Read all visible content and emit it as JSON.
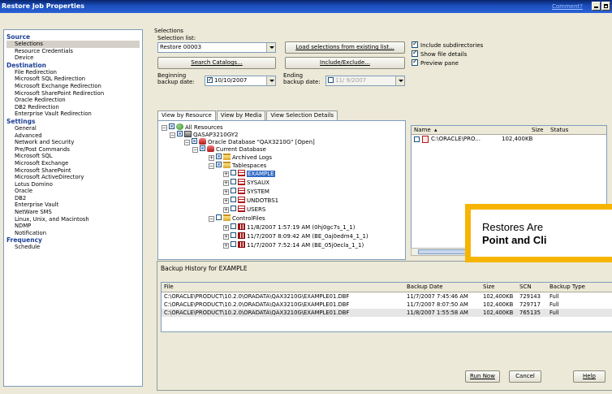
{
  "window": {
    "title": "Restore Job Properties",
    "help_link": "Comment?"
  },
  "nav": [
    {
      "group": "Source",
      "items": [
        "Selections",
        "Resource Credentials",
        "Device"
      ],
      "selected": 0
    },
    {
      "group": "Destination",
      "items": [
        "File Redirection",
        "Microsoft SQL Redirection",
        "Microsoft Exchange Redirection",
        "Microsoft SharePoint Redirection",
        "Oracle Redirection",
        "DB2 Redirection",
        "Enterprise Vault Redirection"
      ]
    },
    {
      "group": "Settings",
      "items": [
        "General",
        "Advanced",
        "Network and Security",
        "Pre/Post Commands",
        "Microsoft SQL",
        "Microsoft Exchange",
        "Microsoft SharePoint",
        "Microsoft ActiveDirectory",
        "Lotus Domino",
        "Oracle",
        "DB2",
        "Enterprise Vault",
        "NetWare SMS",
        "Linux, Unix, and Macintosh",
        "NDMP",
        "Notification"
      ]
    },
    {
      "group": "Frequency",
      "items": [
        "Schedule"
      ]
    }
  ],
  "selections": {
    "section_label": "Selections",
    "list_label": "Selection list:",
    "list_value": "Restore 00003",
    "load_button": "Load selections from existing list...",
    "search_button": "Search Catalogs...",
    "include_button": "Include/Exclude...",
    "begin_label": "Beginning backup date:",
    "begin_value": "10/10/2007",
    "end_label": "Ending backup date:",
    "end_value": "11/ 9/2007",
    "options": [
      {
        "label": "Include subdirectories",
        "checked": true
      },
      {
        "label": "Show file details",
        "checked": true
      },
      {
        "label": "Preview pane",
        "checked": true
      }
    ]
  },
  "tabs": [
    "View by Resource",
    "View by Media",
    "View Selection Details"
  ],
  "tree": [
    {
      "label": "All Resources",
      "icon": "globe-icon"
    },
    {
      "label": "QASAP3210GY2",
      "icon": "server-icon"
    },
    {
      "label": "Oracle Database \"QAX3210G\" [Open]",
      "icon": "database-icon"
    },
    {
      "label": "Current Database",
      "icon": "database-icon"
    },
    {
      "label": "Archived Logs",
      "icon": "folder-icon"
    },
    {
      "label": "Tablespaces",
      "icon": "folder-icon"
    },
    {
      "label": "EXAMPLE",
      "icon": "table-icon",
      "selected": true
    },
    {
      "label": "SYSAUX",
      "icon": "table-icon"
    },
    {
      "label": "SYSTEM",
      "icon": "table-icon"
    },
    {
      "label": "UNDOTBS1",
      "icon": "table-icon"
    },
    {
      "label": "USERS",
      "icon": "table-icon"
    },
    {
      "label": "ControlFiles",
      "icon": "folder-icon"
    },
    {
      "label": "11/8/2007 1:57:19 AM (0hj0gc7s_1_1)",
      "icon": "file-icon"
    },
    {
      "label": "11/7/2007 8:09:42 AM (BE_0aj0edm4_1_1)",
      "icon": "file-icon"
    },
    {
      "label": "11/7/2007 7:52:14 AM (BE_05j0ecla_1_1)",
      "icon": "file-icon"
    }
  ],
  "file_list": {
    "headers": [
      "Name",
      "Size",
      "Status"
    ],
    "rows": [
      {
        "name": "C:\\ORACLE\\PRO...",
        "size": "102,400KB",
        "status": ""
      }
    ]
  },
  "history": {
    "caption": "Backup History for EXAMPLE",
    "headers": [
      "File",
      "Backup Date",
      "Size",
      "SCN",
      "Backup Type"
    ],
    "rows": [
      {
        "file": "C:\\ORACLE\\PRODUCT\\10.2.0\\ORADATA\\QAX3210G\\EXAMPLE01.DBF",
        "date": "11/7/2007 7:45:46 AM",
        "size": "102,400KB",
        "scn": "729143",
        "type": "Full"
      },
      {
        "file": "C:\\ORACLE\\PRODUCT\\10.2.0\\ORADATA\\QAX3210G\\EXAMPLE01.DBF",
        "date": "11/7/2007 8:07:50 AM",
        "size": "102,400KB",
        "scn": "729717",
        "type": "Full"
      },
      {
        "file": "C:\\ORACLE\\PRODUCT\\10.2.0\\ORADATA\\QAX3210G\\EXAMPLE01.DBF",
        "date": "11/8/2007 1:55:58 AM",
        "size": "102,400KB",
        "scn": "765135",
        "type": "Full"
      }
    ]
  },
  "callout": {
    "line1": "Restores Are",
    "line2": "Point and Cli"
  },
  "buttons": {
    "run_now": "Run Now",
    "cancel": "Cancel",
    "help": "Help"
  }
}
